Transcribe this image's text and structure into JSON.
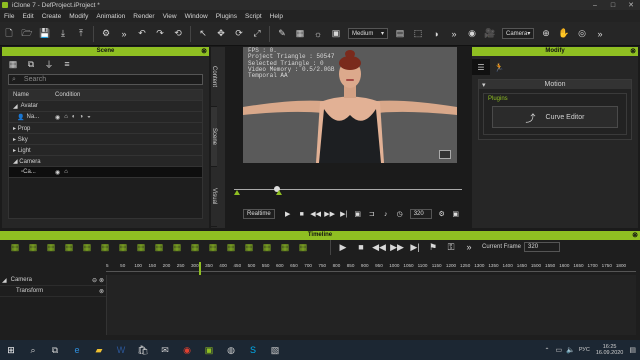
{
  "window": {
    "title": "iClone 7 - DefProject.iProject *"
  },
  "menu": [
    "File",
    "Edit",
    "Create",
    "Modify",
    "Animation",
    "Render",
    "View",
    "Window",
    "Plugins",
    "Script",
    "Help"
  ],
  "toolbar": {
    "quality": "Medium",
    "camera": "Camera"
  },
  "scene": {
    "title": "Scene",
    "search_placeholder": "Search",
    "col_name": "Name",
    "col_condition": "Condition",
    "rows": [
      {
        "label": "Avatar"
      },
      {
        "label": "Na..."
      },
      {
        "label": "Prop"
      },
      {
        "label": "Sky"
      },
      {
        "label": "Light"
      },
      {
        "label": "Camera"
      },
      {
        "label": "Ca..."
      }
    ]
  },
  "side_tabs": [
    "Content",
    "Scene",
    "Visual"
  ],
  "viewport": {
    "fps": "FPS : 0.",
    "project_triangle": "Project Triangle : 50547",
    "selected_triangle": "Selected Triangle : 0",
    "video_memory": "Video Memory : 0.5/2.0GB",
    "aa": "Temporal AA"
  },
  "playback": {
    "mode": "Realtime",
    "frame": "320"
  },
  "modify": {
    "title": "Modify",
    "section": "Motion",
    "group": "Plugins",
    "curve_editor": "Curve Editor"
  },
  "timeline": {
    "title": "Timeline",
    "current_frame_label": "Current Frame",
    "current_frame": "320",
    "ticks": [
      "5",
      "50",
      "100",
      "150",
      "200",
      "250",
      "300",
      "350",
      "400",
      "450",
      "500",
      "550",
      "600",
      "650",
      "700",
      "750",
      "800",
      "850",
      "900",
      "950",
      "1000",
      "1050",
      "1100",
      "1150",
      "1200",
      "1250",
      "1300",
      "1350",
      "1400",
      "1450",
      "1500",
      "1550",
      "1600",
      "1650",
      "1700",
      "1750",
      "1800"
    ],
    "tracks": [
      {
        "label": "Camera"
      },
      {
        "label": "Transform"
      }
    ]
  },
  "taskbar": {
    "lang": "РУС",
    "time": "16:25",
    "date": "16.09.2020"
  },
  "colors": {
    "accent": "#8fbf22"
  }
}
